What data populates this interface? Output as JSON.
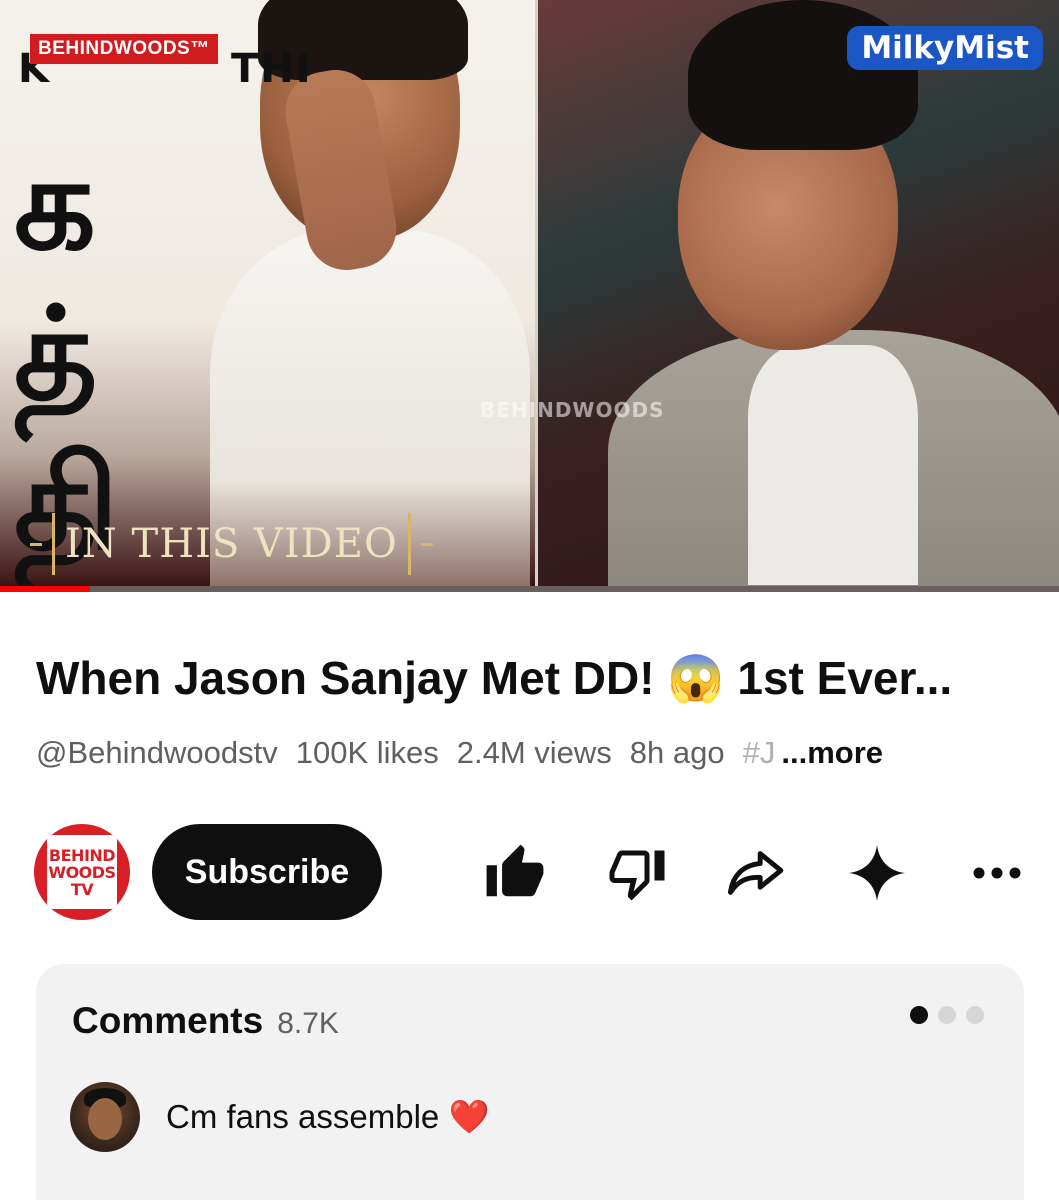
{
  "player": {
    "badge": "BEHINDWOODS™",
    "film_title_left": "K",
    "film_title_right": "THI",
    "tamil_letters": [
      "க",
      "த்",
      "தி"
    ],
    "sponsor": "MilkyMist",
    "watermark": "BEHINDWOODS",
    "in_this_video": "IN THIS VIDEO",
    "progress_fraction": 0.085
  },
  "video": {
    "title": "When Jason Sanjay Met DD! 😱  1st  Ever...",
    "channel_handle": "@Behindwoodstv",
    "likes": "100K likes",
    "views": "2.4M views",
    "age": "8h ago",
    "hashtag": "#J",
    "more": "...more"
  },
  "channel": {
    "avatar_line1": "BEHIND",
    "avatar_line2": "WOODS",
    "avatar_line3": "TV",
    "subscribe_label": "Subscribe"
  },
  "icons": [
    "thumbs-up-filled",
    "thumbs-down",
    "share-arrow",
    "remix-sparkle",
    "more-horizontal"
  ],
  "colors": {
    "accent_red": "#ff0000",
    "subscribe_bg": "#0f0f0f",
    "comments_bg": "#f2f2f2",
    "heart": "#e02434"
  },
  "comments": {
    "label": "Comments",
    "count": "8.7K",
    "pager_count": 3,
    "pager_active": 0,
    "top_comment": {
      "text": "Cm fans assemble",
      "emoji": "❤️"
    }
  }
}
